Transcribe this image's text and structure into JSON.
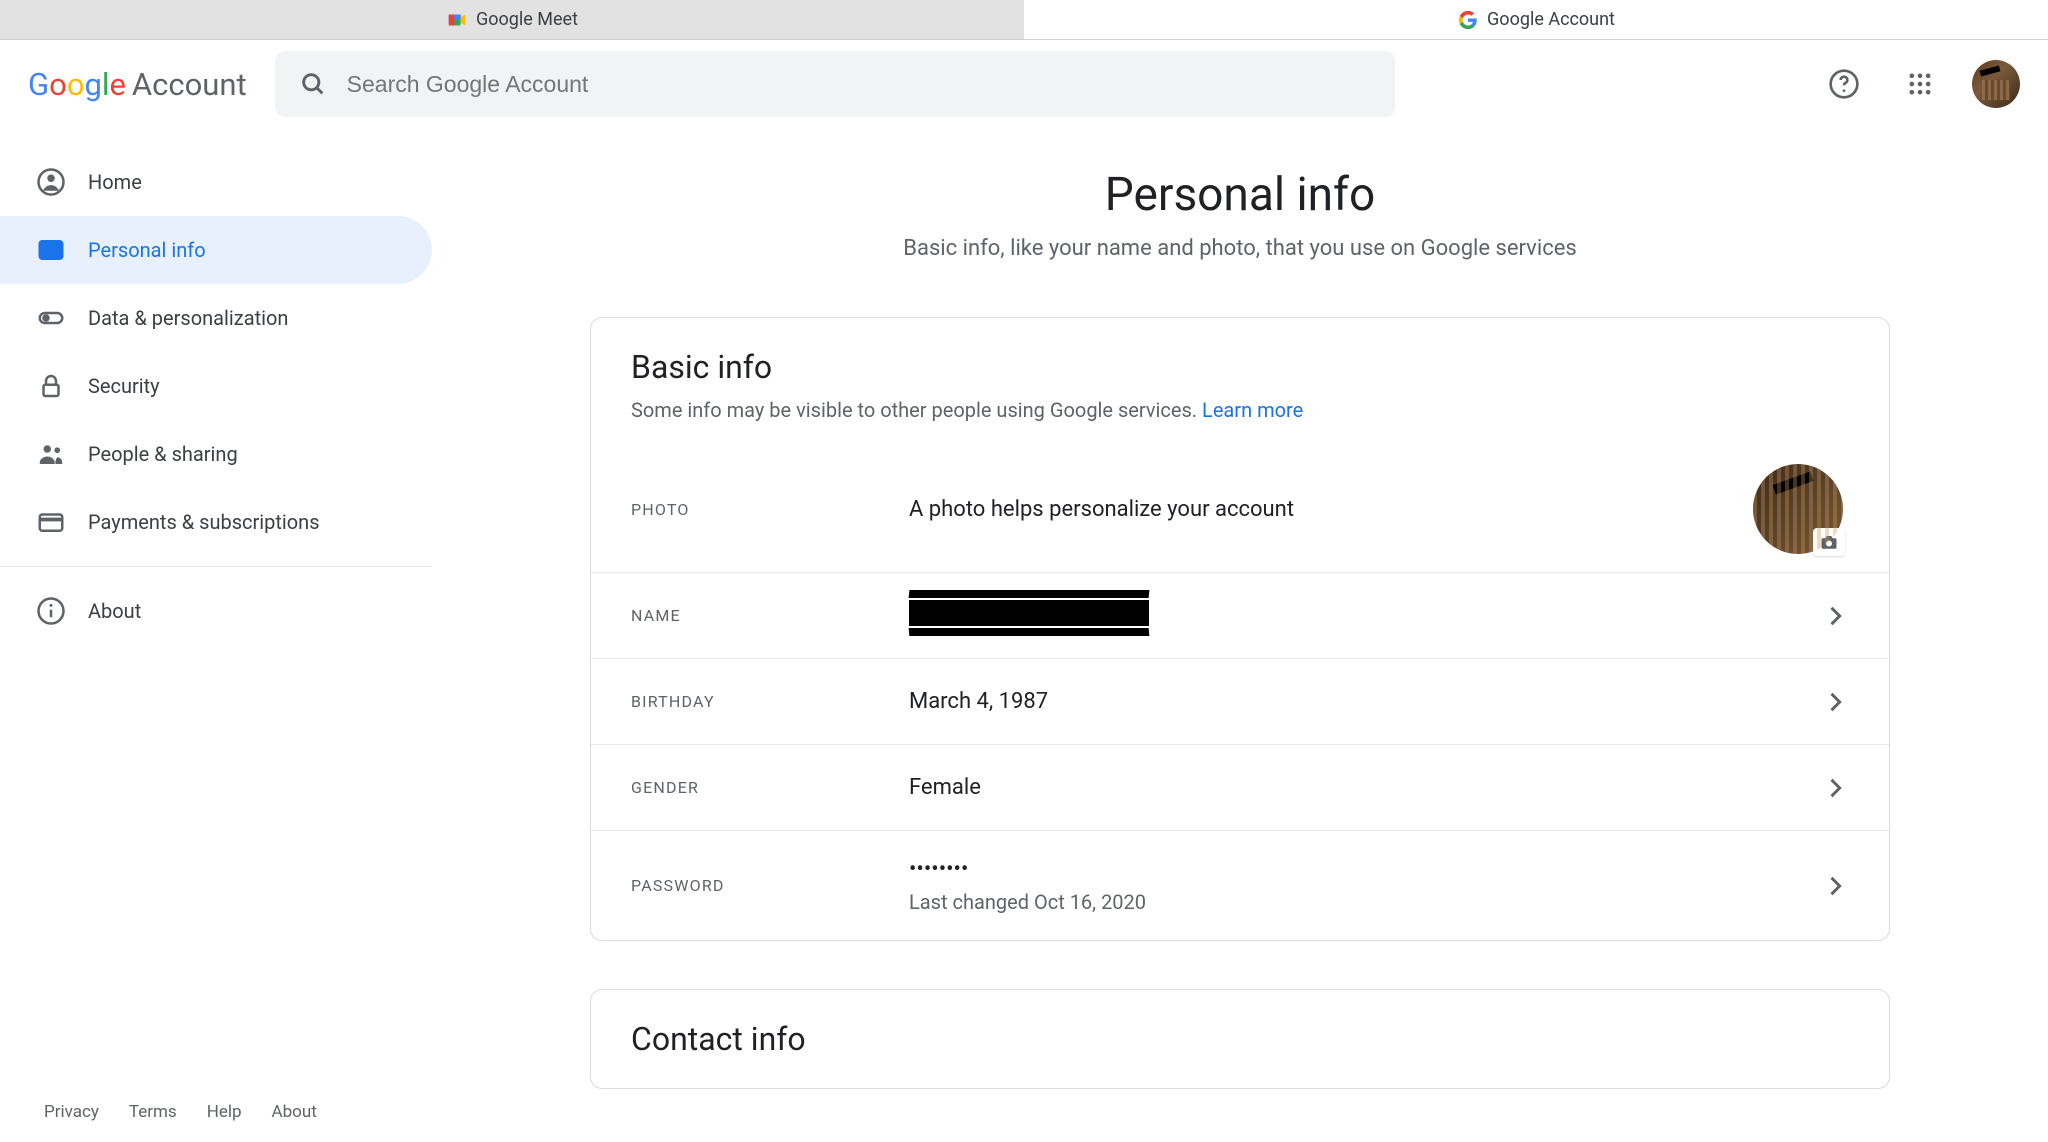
{
  "tabs": {
    "left": "Google Meet",
    "right": "Google Account"
  },
  "logo": {
    "account_word": "Account"
  },
  "search": {
    "placeholder": "Search Google Account"
  },
  "sidebar": {
    "items": [
      {
        "label": "Home"
      },
      {
        "label": "Personal info"
      },
      {
        "label": "Data & personalization"
      },
      {
        "label": "Security"
      },
      {
        "label": "People & sharing"
      },
      {
        "label": "Payments & subscriptions"
      },
      {
        "label": "About"
      }
    ]
  },
  "footer": {
    "privacy": "Privacy",
    "terms": "Terms",
    "help": "Help",
    "about": "About"
  },
  "page": {
    "title": "Personal info",
    "subtitle": "Basic info, like your name and photo, that you use on Google services"
  },
  "basic": {
    "title": "Basic info",
    "subtitle": "Some info may be visible to other people using Google services. ",
    "learn_more": "Learn more",
    "photo": {
      "label": "Photo",
      "desc": "A photo helps personalize your account"
    },
    "name": {
      "label": "Name"
    },
    "birthday": {
      "label": "Birthday",
      "value": "March 4, 1987"
    },
    "gender": {
      "label": "Gender",
      "value": "Female"
    },
    "password": {
      "label": "Password",
      "value": "••••••••",
      "sub": "Last changed Oct 16, 2020"
    }
  },
  "contact": {
    "title": "Contact info"
  }
}
